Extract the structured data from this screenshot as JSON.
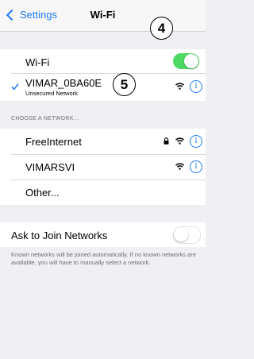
{
  "nav": {
    "back_label": "Settings",
    "title": "Wi-Fi"
  },
  "callouts": {
    "a": "4",
    "b": "5"
  },
  "wifi_toggle": {
    "label": "Wi-Fi",
    "state": "on"
  },
  "connected": {
    "name": "VIMAR_0BA60E",
    "subtitle": "Unsecured Network"
  },
  "section_header": "CHOOSE A NETWORK...",
  "networks": [
    {
      "name": "FreeInternet",
      "locked": true
    },
    {
      "name": "VIMARSVI",
      "locked": false
    },
    {
      "name": "Other..."
    }
  ],
  "ask_join": {
    "label": "Ask to Join Networks",
    "state": "off"
  },
  "footer": "Known networks will be joined automatically. If no known networks are available, you will have to manually select a network.",
  "colors": {
    "accent": "#1e7cf2",
    "toggle_on": "#4cd964",
    "background": "#efeff4"
  }
}
